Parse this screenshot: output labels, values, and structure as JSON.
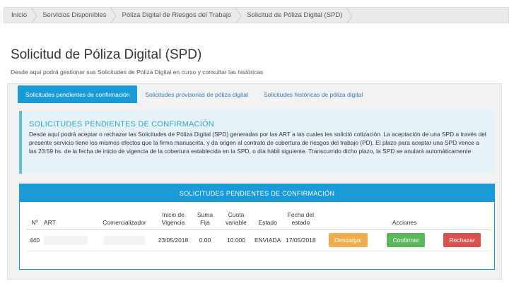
{
  "breadcrumb": [
    {
      "label": "Inicio"
    },
    {
      "label": "Servicios Disponibles"
    },
    {
      "label": "Póliza Digital de Riesgos del Trabajo"
    },
    {
      "label": "Solicitud de Póliza Digital (SPD)"
    }
  ],
  "page": {
    "title": "Solicitud de Póliza Digital (SPD)",
    "subtitle": "Desde aquí podrá gestionar sus Solicitudes de Póliza Digital en curso y consultar las históricas"
  },
  "tabs": [
    {
      "label": "Solicitudes pendientes de confirmación",
      "active": true
    },
    {
      "label": "Solicitudes provisorias de póliza digital",
      "active": false
    },
    {
      "label": "Solicitudes históricas de póliza digital",
      "active": false
    }
  ],
  "alert": {
    "title": "SOLICITUDES PENDIENTES DE CONFIRMACIÓN",
    "text": "Desde aquí podrá aceptar o rechazar las Solicitudes de Póliza Digital (SPD) generadas por las ART a las cuales les solicitó cotización. La aceptación de una SPD a través del presente servicio tiene los mismos efectos que la firma manuscrita, y da origen al contrato de cobertura de riesgos del trabajo (PD). El plazo para aceptar una SPD vence a las 23:59 hs. de la fecha de inicio de vigencia de la cobertura establecida en la SPD, o día hábil siguiente. Transcurrido dicho plazo, la SPD se anulará automáticamente"
  },
  "card": {
    "header": "SOLICITUDES PENDIENTES DE CONFIRMACIÓN"
  },
  "table": {
    "headers": {
      "n": "Nº",
      "art": "ART",
      "comercializador": "Comercializador",
      "inicio": "Inicio de Vigencia",
      "suma": "Suma Fija",
      "cuota": "Cuota variable",
      "estado": "Estado",
      "fecha": "Fecha del estado",
      "acciones": "Acciones"
    },
    "rows": [
      {
        "n": "440",
        "art": "",
        "comercializador": "",
        "inicio": "23/05/2018",
        "suma": "0.00",
        "cuota": "10.000",
        "estado": "ENVIADA",
        "fecha": "17/05/2018",
        "descargar": "Descargar",
        "confirmar": "Confirmar",
        "rechazar": "Rechazar"
      }
    ]
  },
  "colors": {
    "primary": "#1a9bd7",
    "info_border": "#5bc0de",
    "warning": "#f0ad4e",
    "success": "#5cb85c",
    "danger": "#d9534f"
  },
  "icons": {
    "breadcrumb_separator": "chevron-right-icon"
  }
}
